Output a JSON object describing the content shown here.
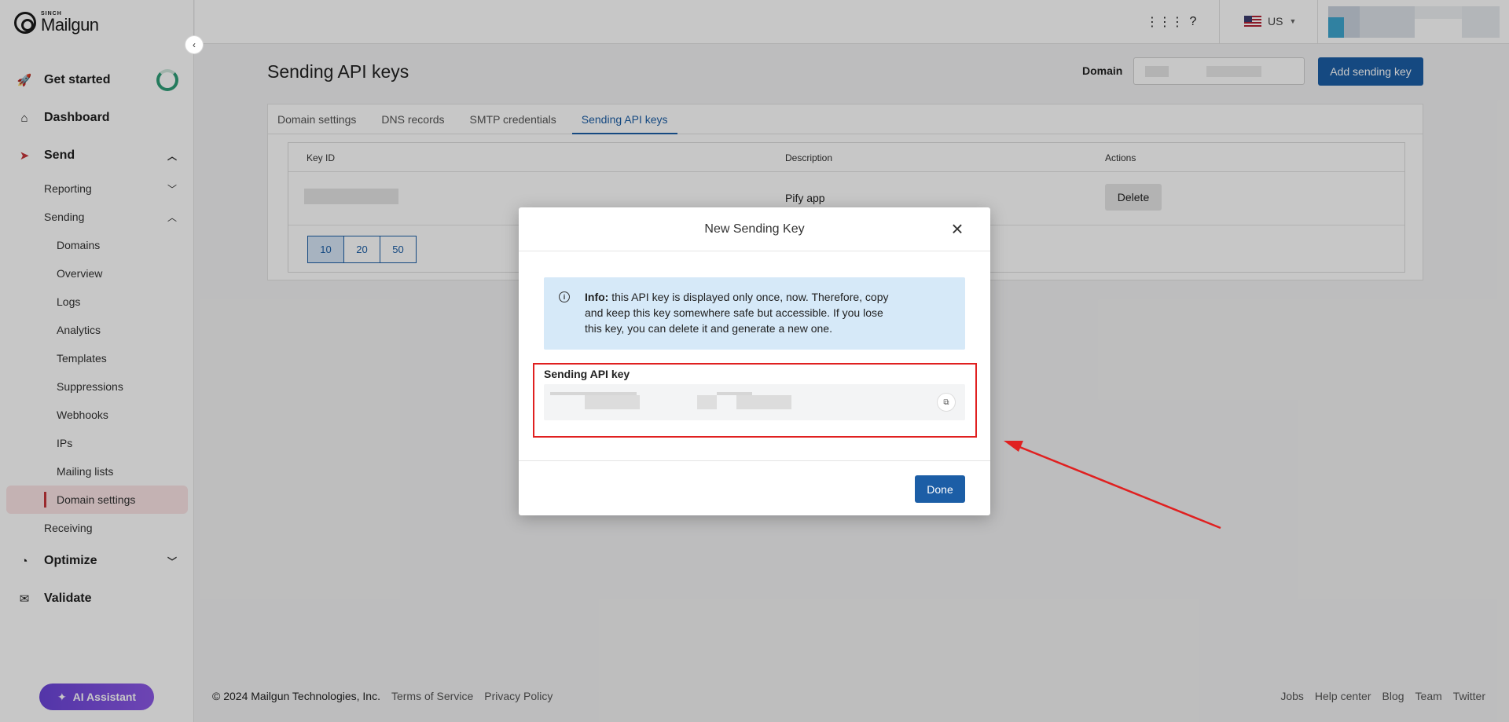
{
  "brand": {
    "sinch": "SINCH",
    "name": "Mailgun"
  },
  "sidebar": {
    "items": [
      {
        "label": "Get started"
      },
      {
        "label": "Dashboard"
      },
      {
        "label": "Send"
      },
      {
        "label": "Reporting"
      },
      {
        "label": "Sending"
      },
      {
        "label": "Domains"
      },
      {
        "label": "Overview"
      },
      {
        "label": "Logs"
      },
      {
        "label": "Analytics"
      },
      {
        "label": "Templates"
      },
      {
        "label": "Suppressions"
      },
      {
        "label": "Webhooks"
      },
      {
        "label": "IPs"
      },
      {
        "label": "Mailing lists"
      },
      {
        "label": "Domain settings"
      },
      {
        "label": "Receiving"
      },
      {
        "label": "Optimize"
      },
      {
        "label": "Validate"
      }
    ],
    "ai_assistant": "AI Assistant"
  },
  "topbar": {
    "region": "US"
  },
  "main": {
    "title": "Sending API keys",
    "domain_label": "Domain",
    "add_button": "Add sending key",
    "tabs": [
      "Domain settings",
      "DNS records",
      "SMTP credentials",
      "Sending API keys"
    ],
    "table": {
      "headers": [
        "Key ID",
        "Description",
        "Actions"
      ],
      "rows": [
        {
          "description": "Pify app",
          "action": "Delete"
        }
      ]
    },
    "pager": [
      "10",
      "20",
      "50"
    ]
  },
  "modal": {
    "title": "New Sending Key",
    "info_label": "Info:",
    "info_text": " this API key is displayed only once, now. Therefore, copy and keep this key somewhere safe but accessible. If you lose this key, you can delete it and generate a new one.",
    "key_label": "Sending API key",
    "done": "Done"
  },
  "footer": {
    "copyright": "© 2024 Mailgun Technologies, Inc.",
    "left_links": [
      "Terms of Service",
      "Privacy Policy"
    ],
    "right_links": [
      "Jobs",
      "Help center",
      "Blog",
      "Team",
      "Twitter"
    ]
  },
  "colors": {
    "primary": "#1c5ea6",
    "annotation": "#e02020",
    "active_nav_bg": "#fbe4e6"
  }
}
